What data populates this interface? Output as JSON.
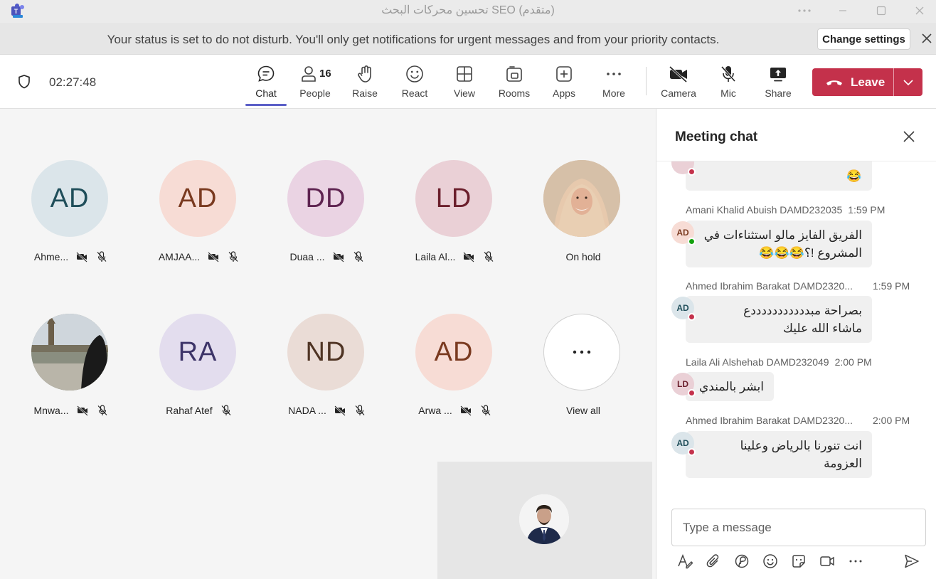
{
  "window": {
    "title": "تحسين محركات البحث SEO (متقدم)"
  },
  "banner": {
    "message": "Your status is set to do not disturb. You'll only get notifications for urgent messages and from your priority contacts.",
    "change_settings": "Change settings"
  },
  "toolbar": {
    "timer": "02:27:48",
    "chat": "Chat",
    "people": "People",
    "people_count": "16",
    "raise": "Raise",
    "react": "React",
    "view": "View",
    "rooms": "Rooms",
    "apps": "Apps",
    "more": "More",
    "camera": "Camera",
    "mic": "Mic",
    "share": "Share",
    "leave": "Leave"
  },
  "participants": [
    {
      "initials": "AD",
      "name": "Ahme...",
      "bg": "#dbe5ea",
      "fg": "#1f4e5a"
    },
    {
      "initials": "AD",
      "name": "AMJAA...",
      "bg": "#f7dcd5",
      "fg": "#7a3a20"
    },
    {
      "initials": "DD",
      "name": "Duaa ...",
      "bg": "#ead3e3",
      "fg": "#5e2350"
    },
    {
      "initials": "LD",
      "name": "Laila Al...",
      "bg": "#ead0d6",
      "fg": "#6b1f2c"
    },
    {
      "initials": "",
      "name": "On hold",
      "bg": "#d9b69a",
      "fg": "#000000"
    },
    {
      "initials": "",
      "name": "Mnwa...",
      "bg": "#8d9488",
      "fg": "#000000"
    },
    {
      "initials": "RA",
      "name": "Rahaf Atef",
      "bg": "#e3ddee",
      "fg": "#3d3468"
    },
    {
      "initials": "ND",
      "name": "NADA ...",
      "bg": "#eadcd6",
      "fg": "#4f3424"
    },
    {
      "initials": "AD",
      "name": "Arwa ...",
      "bg": "#f7dcd5",
      "fg": "#7a3a20"
    },
    {
      "initials": "",
      "name": "View all",
      "bg": "#ffffff",
      "fg": "#242424"
    }
  ],
  "chat": {
    "title": "Meeting chat",
    "partial_emoji": "😂",
    "messages": [
      {
        "sender": "Amani Khalid Abuish DAMD232035",
        "time": "1:59 PM",
        "initials": "AD",
        "line1": "الفريق الفايز مالو استثناءات في",
        "line2": "المشروع !؟😂😂😂",
        "status": "available"
      },
      {
        "sender": "Ahmed Ibrahim Barakat DAMD2320...",
        "time": "1:59 PM",
        "initials": "AD",
        "line1": "بصراحة مبدددددددددددع",
        "line2": "ماشاء الله عليك",
        "status": "dnd"
      },
      {
        "sender": "Laila Ali Alshehab DAMD232049",
        "time": "2:00 PM",
        "initials": "LD",
        "line1": "ابشر بالمندي",
        "line2": "",
        "status": "dnd"
      },
      {
        "sender": "Ahmed Ibrahim Barakat DAMD2320...",
        "time": "2:00 PM",
        "initials": "AD",
        "line1": "انت تنورنا بالرياض وعلينا",
        "line2": "العزومة",
        "status": "dnd"
      }
    ],
    "compose_placeholder": "Type a message"
  },
  "colors": {
    "accent": "#5b5fc7",
    "leave": "#c4314b",
    "dnd": "#c4314b",
    "available": "#13a10e"
  }
}
